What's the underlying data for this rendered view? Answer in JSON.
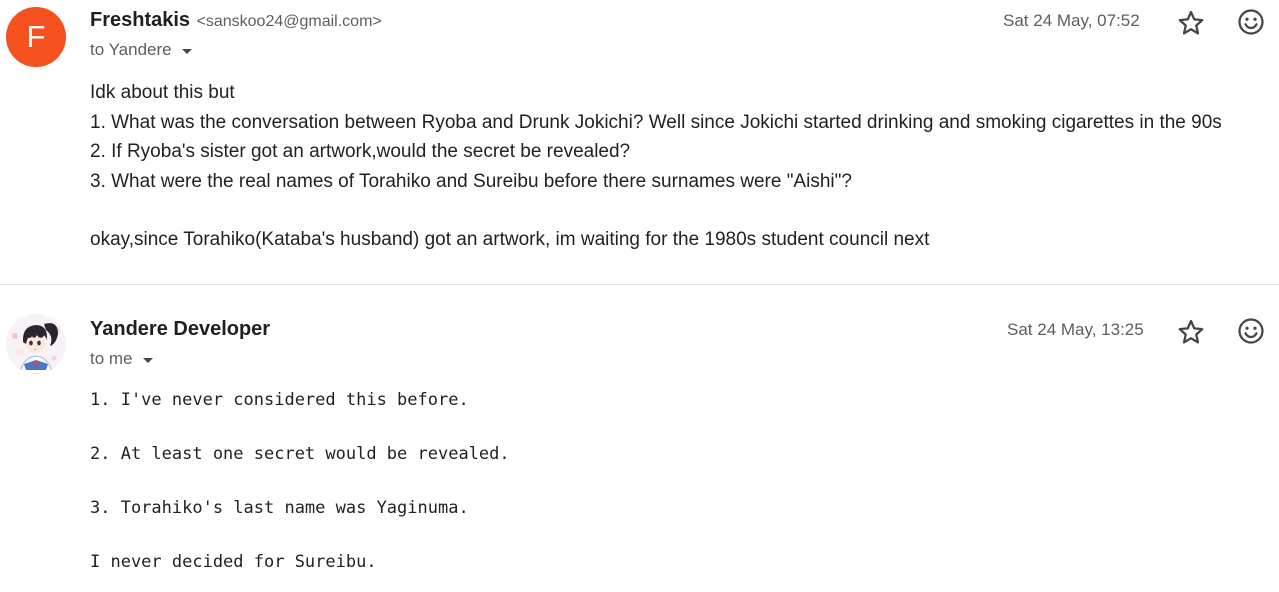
{
  "messages": [
    {
      "avatar_letter": "F",
      "avatar_color": "#f4511e",
      "sender_name": "Freshtakis",
      "sender_email": "<sanskoo24@gmail.com>",
      "to_line": "to Yandere",
      "date": "Sat 24 May, 07:52",
      "body_lines": [
        "Idk about this but",
        "1. What was the conversation between Ryoba and Drunk Jokichi? Well since Jokichi started drinking and smoking cigarettes in the 90s",
        "2. If Ryoba's sister got an artwork,would the secret be revealed?",
        "3. What were the real names of Torahiko and Sureibu before there surnames were \"Aishi\"?",
        "",
        "okay,since Torahiko(Kataba's husband) got an artwork, im waiting for the 1980s student council next"
      ]
    },
    {
      "avatar_image": "anime-character-avatar",
      "sender_name": "Yandere Developer",
      "to_line": "to me",
      "date": "Sat 24 May, 13:25",
      "body_lines": [
        "1. I've never considered this before.",
        "",
        "2. At least one secret would be revealed.",
        "",
        "3. Torahiko's last name was Yaginuma.",
        "",
        "I never decided for Sureibu."
      ]
    }
  ],
  "icons": {
    "star": "star-icon",
    "emoji": "emoji-reaction-icon",
    "caret": "chevron-down-icon"
  }
}
